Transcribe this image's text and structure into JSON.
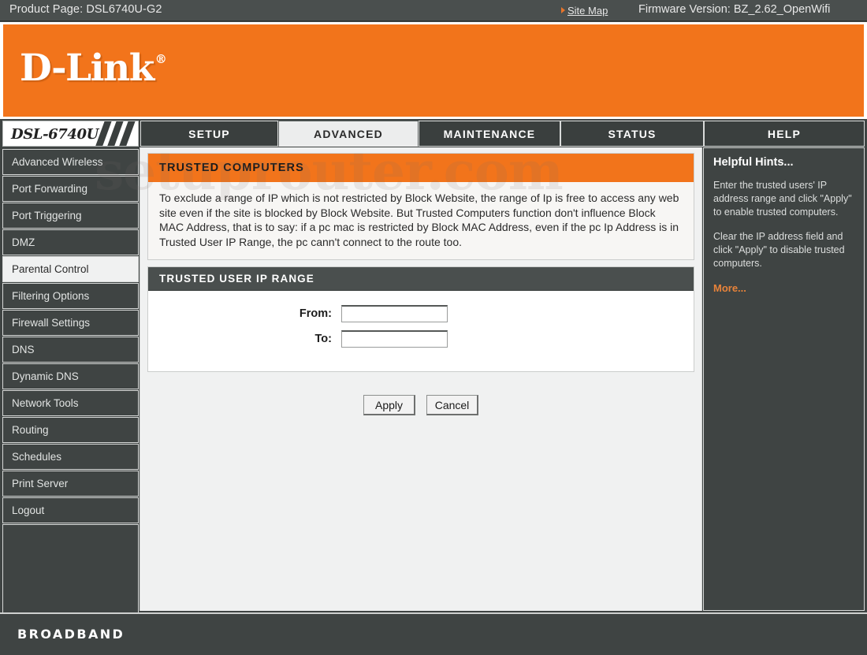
{
  "topbar": {
    "product_page": "Product Page: DSL6740U-G2",
    "site_map": "Site Map",
    "firmware": "Firmware Version: BZ_2.62_OpenWifi"
  },
  "brand": {
    "logo": "D-Link",
    "registered_mark": "®",
    "banner_color": "#f2741b"
  },
  "watermark": "setuprouter.com",
  "nav": {
    "model": "DSL-6740U",
    "tabs": [
      {
        "label": "SETUP",
        "active": false
      },
      {
        "label": "ADVANCED",
        "active": true
      },
      {
        "label": "MAINTENANCE",
        "active": false
      },
      {
        "label": "STATUS",
        "active": false
      },
      {
        "label": "HELP",
        "active": false
      }
    ]
  },
  "sidebar": {
    "items": [
      {
        "label": "Advanced Wireless",
        "active": false
      },
      {
        "label": "Port Forwarding",
        "active": false
      },
      {
        "label": "Port Triggering",
        "active": false
      },
      {
        "label": "DMZ",
        "active": false
      },
      {
        "label": "Parental Control",
        "active": true
      },
      {
        "label": "Filtering Options",
        "active": false
      },
      {
        "label": "Firewall Settings",
        "active": false
      },
      {
        "label": "DNS",
        "active": false
      },
      {
        "label": "Dynamic DNS",
        "active": false
      },
      {
        "label": "Network Tools",
        "active": false
      },
      {
        "label": "Routing",
        "active": false
      },
      {
        "label": "Schedules",
        "active": false
      },
      {
        "label": "Print Server",
        "active": false
      },
      {
        "label": "Logout",
        "active": false
      }
    ]
  },
  "main": {
    "trusted_computers": {
      "title": "TRUSTED COMPUTERS",
      "description": "To exclude a range of IP which is not restricted by Block Website, the range of Ip is free to access any web site even if the site is blocked by Block Website. But Trusted Computers function don't influence Block MAC Address, that is to say: if a pc mac is restricted by Block MAC Address, even if the pc Ip Address is in Trusted User IP Range, the pc cann't connect to the route too."
    },
    "trusted_user_ip_range": {
      "title": "TRUSTED USER IP RANGE",
      "from_label": "From:",
      "from_value": "",
      "to_label": "To:",
      "to_value": ""
    },
    "buttons": {
      "apply": "Apply",
      "cancel": "Cancel"
    }
  },
  "hints": {
    "title": "Helpful Hints...",
    "paragraphs": [
      "Enter the trusted users' IP address range and click \"Apply\" to enable trusted computers.",
      "Clear the IP address field and click \"Apply\" to disable trusted computers."
    ],
    "more": "More..."
  },
  "footer": {
    "text": "BROADBAND"
  }
}
